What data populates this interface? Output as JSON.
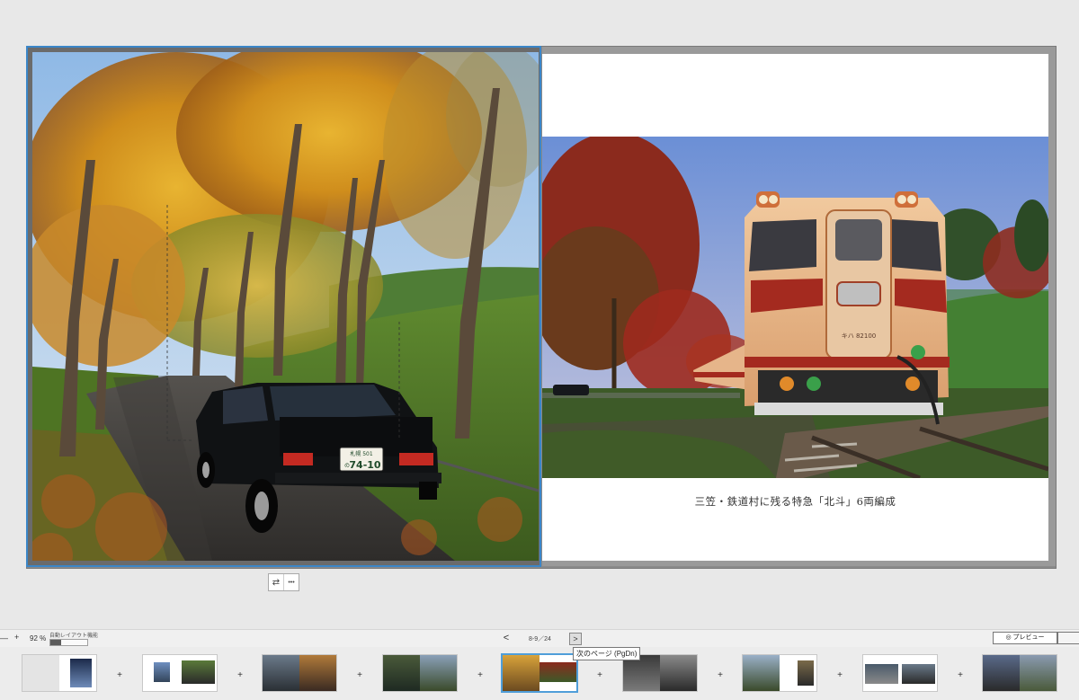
{
  "caption": "三笠・鉄道村に残る特急「北斗」6両編成",
  "left_photo": {
    "plate_line1": "札幌 501",
    "plate_line2": "74-10",
    "plate_hira": "の"
  },
  "right_photo": {
    "loco_number": "キハ 82100"
  },
  "photo_toolbar": [
    {
      "icon": "swap-icon",
      "label": "⇄"
    },
    {
      "icon": "more-icon",
      "label": "•••"
    }
  ],
  "bottom_bar": {
    "zoom_minus": "—",
    "zoom_plus": "+",
    "zoom_level": "92 %",
    "auto_layout_label": "自動レイアウト機能",
    "auto_layout_level": 0.3,
    "prev_symbol": "<",
    "page_indicator": "8-9／24",
    "next_symbol": ">",
    "tooltip": "次のページ (PgDn)",
    "preview_label": "◎ プレビュー"
  },
  "thumbnails": [
    {
      "pages": "0-1",
      "selected": false
    },
    {
      "pages": "2-3",
      "selected": false
    },
    {
      "pages": "4-5",
      "selected": false
    },
    {
      "pages": "6-7",
      "selected": false
    },
    {
      "pages": "8-9",
      "selected": true
    },
    {
      "pages": "10-11",
      "selected": false
    },
    {
      "pages": "12-13",
      "selected": false
    },
    {
      "pages": "14-15",
      "selected": false
    },
    {
      "pages": "16-17",
      "selected": false
    }
  ],
  "separator_symbol": "+",
  "colors": {
    "selection": "#3b86c8",
    "workspace": "#e8e8e8",
    "train_red": "#a42a1f",
    "train_cream": "#e9b98a"
  }
}
